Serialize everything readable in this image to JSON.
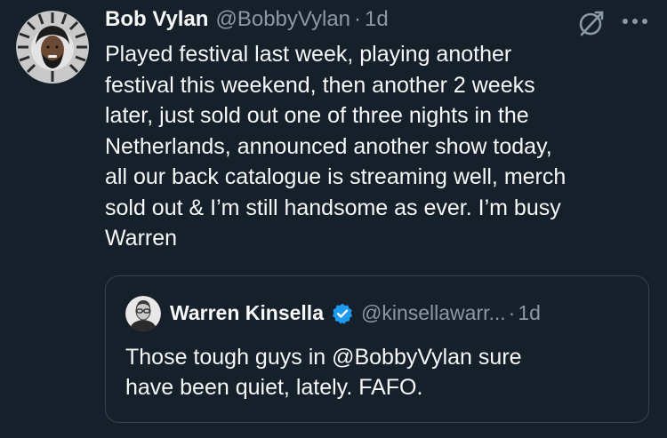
{
  "tweet": {
    "author_name": "Bob Vylan",
    "author_handle": "@BobbyVylan",
    "separator": "·",
    "time": "1d",
    "text_lines": [
      "Played festival last week, playing another",
      "festival this weekend, then another 2 weeks",
      "later, just sold out one of three nights in the",
      "Netherlands, announced another show today,",
      "all our back catalogue is streaming well, merch",
      "sold out & I’m still handsome as ever. I’m busy",
      "Warren"
    ],
    "icons": {
      "grok": "grok-icon",
      "more": "more-icon"
    }
  },
  "quote": {
    "author_name": "Warren Kinsella",
    "verified": "verified-badge-icon",
    "author_handle": "@kinsellawarr...",
    "separator": "·",
    "time": "1d",
    "text_lines": [
      "Those tough guys in @BobbyVylan sure",
      "have been quiet, lately. FAFO."
    ]
  },
  "colors": {
    "background": "#15202b",
    "text": "#f7f9f9",
    "secondary_text": "#8b98a5",
    "border": "#38444d",
    "verified": "#1d9bf0"
  }
}
